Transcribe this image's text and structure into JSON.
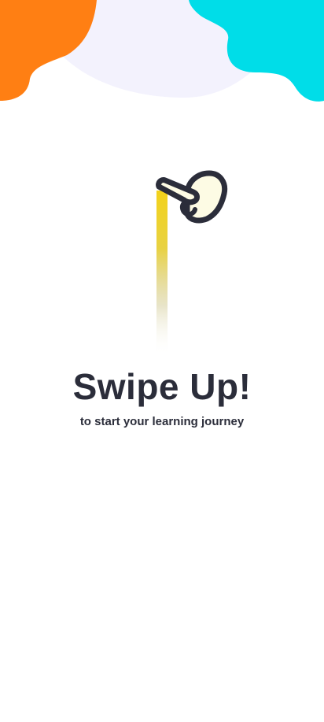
{
  "onboarding": {
    "title": "Swipe Up!",
    "subtitle": "to start your learning journey"
  },
  "icons": {
    "gesture": "hand-swipe-up-icon"
  },
  "colors": {
    "background": "#ffffff",
    "lavender_blob": "#f3f2fd",
    "orange_blob": "#ff7f13",
    "cyan_blob": "#00dde8",
    "trail_yellow": "#f3d21a",
    "hand_fill": "#fdfbe4",
    "outline": "#2b2d3a",
    "text": "#2b2d3a"
  }
}
